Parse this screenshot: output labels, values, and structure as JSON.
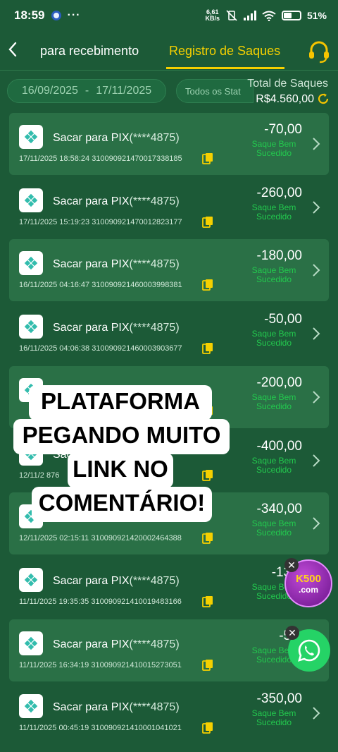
{
  "status_bar": {
    "time": "18:59",
    "more": "···",
    "speed_value": "6,61",
    "speed_unit": "KB/s",
    "battery": "51%"
  },
  "header": {
    "back_icon": "chevron-left-icon",
    "tab_receiving": "para recebimento",
    "tab_withdrawals": "Registro de Saques",
    "support_icon": "headset-icon",
    "accent_color": "#f5d000"
  },
  "filters": {
    "date_start": "16/09/2025",
    "date_sep": "-",
    "date_end": "17/11/2025",
    "status_label": "Todos os Stat"
  },
  "totals": {
    "label": "Total de Saques",
    "value": "R$4.560,00"
  },
  "records": [
    {
      "title": "Sacar para  PIX",
      "account": "(****4875)",
      "datetime": "17/11/2025 18:58:24",
      "tx": "310090921470017338185",
      "amount": "-70,00",
      "status": "Saque Bem Sucedido"
    },
    {
      "title": "Sacar para  PIX",
      "account": "(****4875)",
      "datetime": "17/11/2025 15:19:23",
      "tx": "310090921470012823177",
      "amount": "-260,00",
      "status": "Saque Bem Sucedido"
    },
    {
      "title": "Sacar para  PIX",
      "account": "(****4875)",
      "datetime": "16/11/2025 04:16:47",
      "tx": "310090921460003998381",
      "amount": "-180,00",
      "status": "Saque Bem Sucedido"
    },
    {
      "title": "Sacar para  PIX",
      "account": "(****4875)",
      "datetime": "16/11/2025 04:06:38",
      "tx": "310090921460003903677",
      "amount": "-50,00",
      "status": "Saque Bem Sucedido"
    },
    {
      "title": "",
      "account": "",
      "datetime": "",
      "tx": "",
      "amount": "-200,00",
      "status": "Saque Bem Sucedido"
    },
    {
      "title": "Sac",
      "account": "",
      "datetime": "12/11/2",
      "tx": "876",
      "amount": "-400,00",
      "status": "Saque Bem Sucedido"
    },
    {
      "title": "",
      "account": "",
      "datetime": "12/11/2025 02:15:11",
      "tx": "310090921420002464388",
      "amount": "-340,00",
      "status": "Saque Bem Sucedido"
    },
    {
      "title": "Sacar para  PIX",
      "account": "(****4875)",
      "datetime": "11/11/2025 19:35:35",
      "tx": "310090921410019483166",
      "amount": "-130,",
      "status": "Saque Bem Sucedido"
    },
    {
      "title": "Sacar para  PIX",
      "account": "(****4875)",
      "datetime": "11/11/2025 16:34:19",
      "tx": "310090921410015273051",
      "amount": "-50,",
      "status": "Saque Bem Sucedido"
    },
    {
      "title": "Sacar para  PIX",
      "account": "(****4875)",
      "datetime": "11/11/2025 00:45:19",
      "tx": "310090921410001041021",
      "amount": "-350,00",
      "status": "Saque Bem Sucedido"
    }
  ],
  "overlay": {
    "line1": "PLATAFORMA",
    "line2": "PEGANDO MUITO",
    "line3": "LINK NO",
    "line4": "COMENTÁRIO!"
  },
  "floating": {
    "ad_line1": "K500",
    "ad_line2": ".com",
    "close_glyph": "✕",
    "whatsapp_icon": "whatsapp-icon"
  },
  "colors": {
    "background": "#1c5a37",
    "card_shade": "#2a7046",
    "success": "#23c94e"
  }
}
